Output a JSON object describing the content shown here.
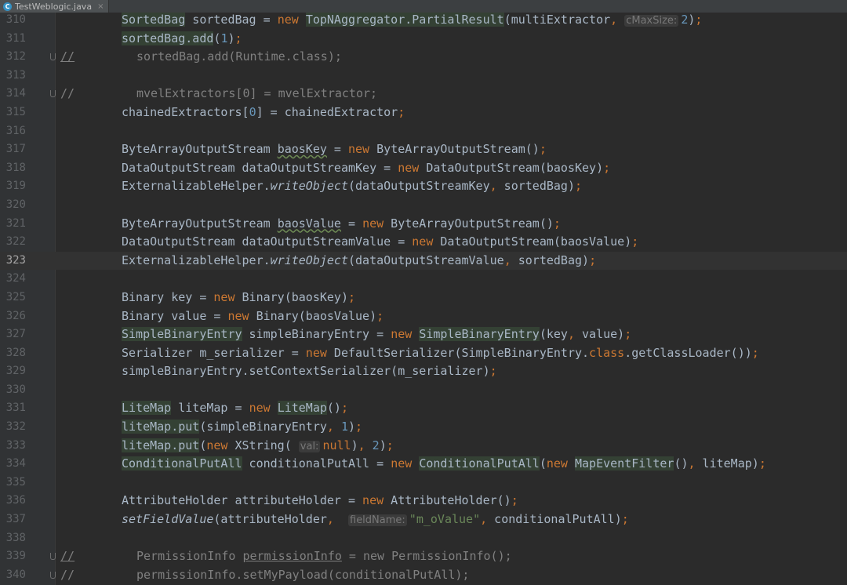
{
  "tab": {
    "filename": "TestWeblogic.java",
    "close": "×",
    "icon": "c-class-icon"
  },
  "lines": [
    {
      "n": "310",
      "marker": "",
      "commented": false,
      "segs": [
        {
          "t": "SortedBag",
          "c": "hl"
        },
        {
          "t": " sortedBag = "
        },
        {
          "t": "new",
          "c": "kw"
        },
        {
          "t": " "
        },
        {
          "t": "TopNAggregator.PartialResult",
          "c": "hl"
        },
        {
          "t": "(multiExtractor"
        },
        {
          "t": ",",
          "c": "kw"
        },
        {
          "t": " "
        },
        {
          "t": "cMaxSize:",
          "c": "hint"
        },
        {
          "t": "2",
          "c": "num"
        },
        {
          "t": ")"
        },
        {
          "t": ";",
          "c": "kw"
        }
      ]
    },
    {
      "n": "311",
      "marker": "",
      "commented": false,
      "segs": [
        {
          "t": "sortedBag.add",
          "c": "hl"
        },
        {
          "t": "("
        },
        {
          "t": "1",
          "c": "num"
        },
        {
          "t": ")"
        },
        {
          "t": ";",
          "c": "kw"
        }
      ]
    },
    {
      "n": "312",
      "marker": "//",
      "markerUnder": true,
      "fold": true,
      "commented": true,
      "segs": [
        {
          "t": "sortedBag.add(Runtime.class);"
        }
      ]
    },
    {
      "n": "313",
      "marker": "",
      "commented": false,
      "segs": []
    },
    {
      "n": "314",
      "marker": "//",
      "markerUnder": false,
      "fold": true,
      "commented": true,
      "segs": [
        {
          "t": "mvelExtractors[0] = mvelExtractor;"
        }
      ]
    },
    {
      "n": "315",
      "marker": "",
      "commented": false,
      "segs": [
        {
          "t": "chainedExtractors["
        },
        {
          "t": "0",
          "c": "num"
        },
        {
          "t": "] = chainedExtractor"
        },
        {
          "t": ";",
          "c": "kw"
        }
      ]
    },
    {
      "n": "316",
      "marker": "",
      "commented": false,
      "segs": []
    },
    {
      "n": "317",
      "marker": "",
      "commented": false,
      "segs": [
        {
          "t": "ByteArrayOutputStream "
        },
        {
          "t": "baosKey",
          "c": "squig"
        },
        {
          "t": " = "
        },
        {
          "t": "new",
          "c": "kw"
        },
        {
          "t": " ByteArrayOutputStream()"
        },
        {
          "t": ";",
          "c": "kw"
        }
      ]
    },
    {
      "n": "318",
      "marker": "",
      "commented": false,
      "segs": [
        {
          "t": "DataOutputStream dataOutputStreamKey = "
        },
        {
          "t": "new",
          "c": "kw"
        },
        {
          "t": " DataOutputStream(baosKey)"
        },
        {
          "t": ";",
          "c": "kw"
        }
      ]
    },
    {
      "n": "319",
      "marker": "",
      "commented": false,
      "segs": [
        {
          "t": "ExternalizableHelper."
        },
        {
          "t": "writeObject",
          "c": "it"
        },
        {
          "t": "(dataOutputStreamKey"
        },
        {
          "t": ",",
          "c": "kw"
        },
        {
          "t": " sortedBag)"
        },
        {
          "t": ";",
          "c": "kw"
        }
      ]
    },
    {
      "n": "320",
      "marker": "",
      "commented": false,
      "segs": []
    },
    {
      "n": "321",
      "marker": "",
      "commented": false,
      "segs": [
        {
          "t": "ByteArrayOutputStream "
        },
        {
          "t": "baosValue",
          "c": "squig"
        },
        {
          "t": " = "
        },
        {
          "t": "new",
          "c": "kw"
        },
        {
          "t": " ByteArrayOutputStream()"
        },
        {
          "t": ";",
          "c": "kw"
        }
      ]
    },
    {
      "n": "322",
      "marker": "",
      "commented": false,
      "segs": [
        {
          "t": "DataOutputStream dataOutputStreamValue = "
        },
        {
          "t": "new",
          "c": "kw"
        },
        {
          "t": " DataOutputStream(baosValue)"
        },
        {
          "t": ";",
          "c": "kw"
        }
      ]
    },
    {
      "n": "323",
      "marker": "",
      "commented": false,
      "current": true,
      "segs": [
        {
          "t": "ExternalizableHelper."
        },
        {
          "t": "writeObject",
          "c": "it"
        },
        {
          "t": "(dataOutputStreamValue"
        },
        {
          "t": ",",
          "c": "kw"
        },
        {
          "t": " sortedBag)"
        },
        {
          "t": ";",
          "c": "kw"
        }
      ]
    },
    {
      "n": "324",
      "marker": "",
      "commented": false,
      "segs": []
    },
    {
      "n": "325",
      "marker": "",
      "commented": false,
      "segs": [
        {
          "t": "Binary key = "
        },
        {
          "t": "new",
          "c": "kw"
        },
        {
          "t": " Binary(baosKey)"
        },
        {
          "t": ";",
          "c": "kw"
        }
      ]
    },
    {
      "n": "326",
      "marker": "",
      "commented": false,
      "segs": [
        {
          "t": "Binary value = "
        },
        {
          "t": "new",
          "c": "kw"
        },
        {
          "t": " Binary(baosValue)"
        },
        {
          "t": ";",
          "c": "kw"
        }
      ]
    },
    {
      "n": "327",
      "marker": "",
      "commented": false,
      "segs": [
        {
          "t": "SimpleBinaryEntry",
          "c": "hl"
        },
        {
          "t": " simpleBinaryEntry = "
        },
        {
          "t": "new",
          "c": "kw"
        },
        {
          "t": " "
        },
        {
          "t": "SimpleBinaryEntry",
          "c": "hl"
        },
        {
          "t": "(key"
        },
        {
          "t": ",",
          "c": "kw"
        },
        {
          "t": " value)"
        },
        {
          "t": ";",
          "c": "kw"
        }
      ]
    },
    {
      "n": "328",
      "marker": "",
      "commented": false,
      "segs": [
        {
          "t": "Serializer m_serializer = "
        },
        {
          "t": "new",
          "c": "kw"
        },
        {
          "t": " DefaultSerializer(SimpleBinaryEntry."
        },
        {
          "t": "class",
          "c": "kw"
        },
        {
          "t": ".getClassLoader())"
        },
        {
          "t": ";",
          "c": "kw"
        }
      ]
    },
    {
      "n": "329",
      "marker": "",
      "commented": false,
      "segs": [
        {
          "t": "simpleBinaryEntry.setContextSerializer(m_serializer)"
        },
        {
          "t": ";",
          "c": "kw"
        }
      ]
    },
    {
      "n": "330",
      "marker": "",
      "commented": false,
      "segs": []
    },
    {
      "n": "331",
      "marker": "",
      "commented": false,
      "segs": [
        {
          "t": "LiteMap",
          "c": "hl"
        },
        {
          "t": " liteMap = "
        },
        {
          "t": "new",
          "c": "kw"
        },
        {
          "t": " "
        },
        {
          "t": "LiteMap",
          "c": "hl"
        },
        {
          "t": "()"
        },
        {
          "t": ";",
          "c": "kw"
        }
      ]
    },
    {
      "n": "332",
      "marker": "",
      "commented": false,
      "segs": [
        {
          "t": "liteMap.put",
          "c": "hl"
        },
        {
          "t": "(simpleBinaryEntry"
        },
        {
          "t": ",",
          "c": "kw"
        },
        {
          "t": " "
        },
        {
          "t": "1",
          "c": "num"
        },
        {
          "t": ")"
        },
        {
          "t": ";",
          "c": "kw"
        }
      ]
    },
    {
      "n": "333",
      "marker": "",
      "commented": false,
      "segs": [
        {
          "t": "liteMap.put",
          "c": "hl"
        },
        {
          "t": "("
        },
        {
          "t": "new",
          "c": "kw"
        },
        {
          "t": " XString( "
        },
        {
          "t": "val:",
          "c": "hint"
        },
        {
          "t": "null",
          "c": "kw"
        },
        {
          "t": ")"
        },
        {
          "t": ",",
          "c": "kw"
        },
        {
          "t": " "
        },
        {
          "t": "2",
          "c": "num"
        },
        {
          "t": ")"
        },
        {
          "t": ";",
          "c": "kw"
        }
      ]
    },
    {
      "n": "334",
      "marker": "",
      "commented": false,
      "segs": [
        {
          "t": "ConditionalPutAll",
          "c": "hl"
        },
        {
          "t": " conditionalPutAll = "
        },
        {
          "t": "new",
          "c": "kw"
        },
        {
          "t": " "
        },
        {
          "t": "ConditionalPutAll",
          "c": "hl"
        },
        {
          "t": "("
        },
        {
          "t": "new",
          "c": "kw"
        },
        {
          "t": " "
        },
        {
          "t": "MapEventFilter",
          "c": "hl"
        },
        {
          "t": "()"
        },
        {
          "t": ",",
          "c": "kw"
        },
        {
          "t": " liteMap)"
        },
        {
          "t": ";",
          "c": "kw"
        }
      ]
    },
    {
      "n": "335",
      "marker": "",
      "commented": false,
      "segs": []
    },
    {
      "n": "336",
      "marker": "",
      "commented": false,
      "segs": [
        {
          "t": "AttributeHolder attributeHolder = "
        },
        {
          "t": "new",
          "c": "kw"
        },
        {
          "t": " AttributeHolder()"
        },
        {
          "t": ";",
          "c": "kw"
        }
      ]
    },
    {
      "n": "337",
      "marker": "",
      "commented": false,
      "segs": [
        {
          "t": "setFieldValue",
          "c": "it"
        },
        {
          "t": "(attributeHolder"
        },
        {
          "t": ",",
          "c": "kw"
        },
        {
          "t": "  "
        },
        {
          "t": "fieldName:",
          "c": "hint"
        },
        {
          "t": "\"m_oValue\"",
          "c": "str"
        },
        {
          "t": ",",
          "c": "kw"
        },
        {
          "t": " conditionalPutAll)"
        },
        {
          "t": ";",
          "c": "kw"
        }
      ]
    },
    {
      "n": "338",
      "marker": "",
      "commented": false,
      "segs": []
    },
    {
      "n": "339",
      "marker": "//",
      "markerUnder": true,
      "fold": true,
      "commented": true,
      "segs": [
        {
          "t": "PermissionInfo "
        },
        {
          "t": "permissionInfo",
          "c": "underline"
        },
        {
          "t": " = new PermissionInfo();"
        }
      ]
    },
    {
      "n": "340",
      "marker": "//",
      "markerUnder": false,
      "fold": true,
      "commented": true,
      "segs": [
        {
          "t": "permissionInfo.setMyPayload(conditionalPutAll);"
        }
      ]
    }
  ]
}
